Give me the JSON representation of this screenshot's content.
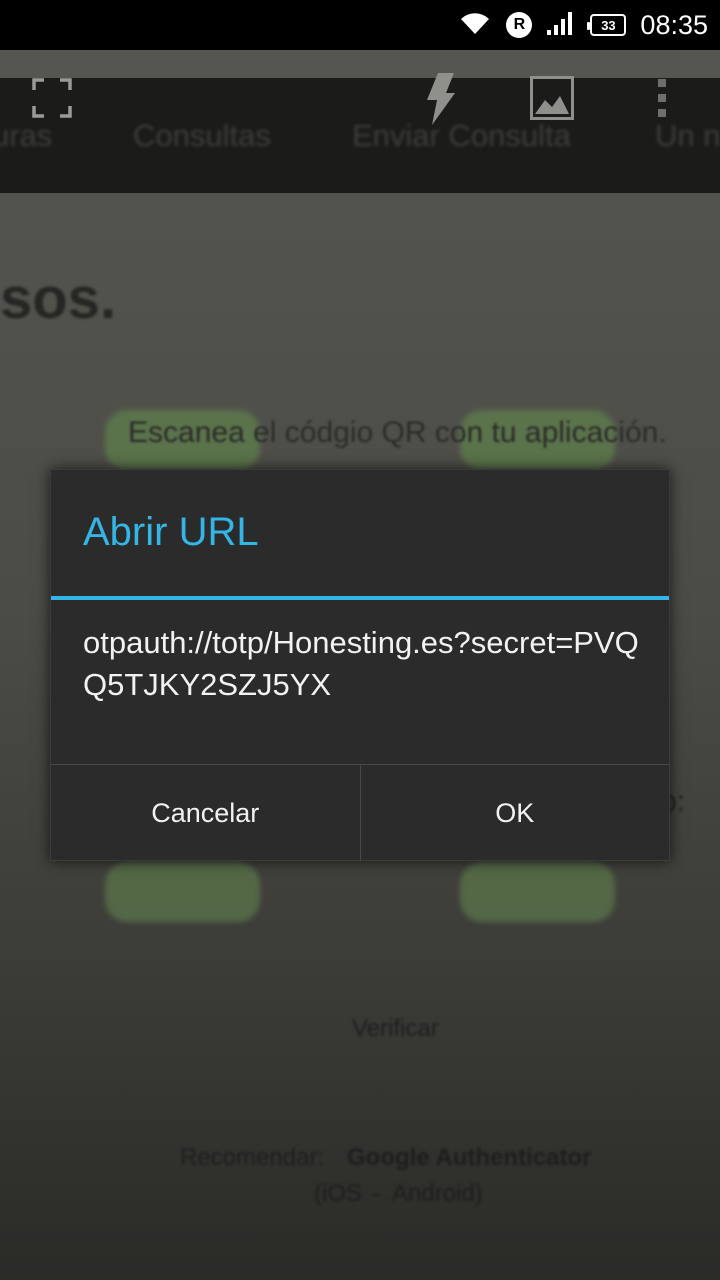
{
  "status_bar": {
    "time": "08:35",
    "battery_level": "33",
    "roaming_badge": "R",
    "icons": [
      "wifi-icon",
      "roaming-icon",
      "signal-icon",
      "battery-icon"
    ]
  },
  "camera_toolbar": {
    "icons": [
      "fullscreen-icon",
      "flash-icon",
      "gallery-icon",
      "overflow-menu-icon"
    ]
  },
  "background_page": {
    "nav_items": [
      "uras",
      "Consultas",
      "Enviar Consulta",
      "Un n"
    ],
    "heading": "sos.",
    "instruction": "Escanea el códgio QR con tu aplicación.",
    "partial_text": "p:",
    "verify_label": "Verificar",
    "recommend_prefix": "Recomendar:",
    "recommend_app": "Google Authenticator",
    "platforms_open": "(iOS",
    "platforms_sep": "-",
    "platforms_android": "Android)"
  },
  "dialog": {
    "title": "Abrir URL",
    "message": "otpauth://totp/Honesting.es?secret=PVQQ5TJKY2SZJ5YX",
    "cancel_label": "Cancelar",
    "ok_label": "OK"
  },
  "colors": {
    "accent": "#33b5e5",
    "dialog_bg": "#2b2b2b",
    "status_bar_bg": "#000000"
  }
}
